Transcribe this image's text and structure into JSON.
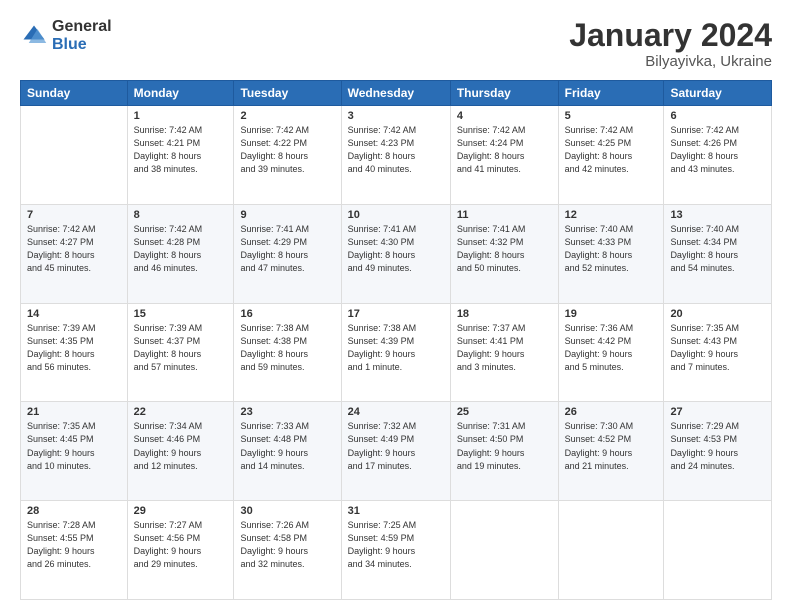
{
  "logo": {
    "general": "General",
    "blue": "Blue"
  },
  "title": {
    "month": "January 2024",
    "location": "Bilyayivka, Ukraine"
  },
  "headers": [
    "Sunday",
    "Monday",
    "Tuesday",
    "Wednesday",
    "Thursday",
    "Friday",
    "Saturday"
  ],
  "weeks": [
    [
      {
        "day": "",
        "info": ""
      },
      {
        "day": "1",
        "info": "Sunrise: 7:42 AM\nSunset: 4:21 PM\nDaylight: 8 hours\nand 38 minutes."
      },
      {
        "day": "2",
        "info": "Sunrise: 7:42 AM\nSunset: 4:22 PM\nDaylight: 8 hours\nand 39 minutes."
      },
      {
        "day": "3",
        "info": "Sunrise: 7:42 AM\nSunset: 4:23 PM\nDaylight: 8 hours\nand 40 minutes."
      },
      {
        "day": "4",
        "info": "Sunrise: 7:42 AM\nSunset: 4:24 PM\nDaylight: 8 hours\nand 41 minutes."
      },
      {
        "day": "5",
        "info": "Sunrise: 7:42 AM\nSunset: 4:25 PM\nDaylight: 8 hours\nand 42 minutes."
      },
      {
        "day": "6",
        "info": "Sunrise: 7:42 AM\nSunset: 4:26 PM\nDaylight: 8 hours\nand 43 minutes."
      }
    ],
    [
      {
        "day": "7",
        "info": "Sunrise: 7:42 AM\nSunset: 4:27 PM\nDaylight: 8 hours\nand 45 minutes."
      },
      {
        "day": "8",
        "info": "Sunrise: 7:42 AM\nSunset: 4:28 PM\nDaylight: 8 hours\nand 46 minutes."
      },
      {
        "day": "9",
        "info": "Sunrise: 7:41 AM\nSunset: 4:29 PM\nDaylight: 8 hours\nand 47 minutes."
      },
      {
        "day": "10",
        "info": "Sunrise: 7:41 AM\nSunset: 4:30 PM\nDaylight: 8 hours\nand 49 minutes."
      },
      {
        "day": "11",
        "info": "Sunrise: 7:41 AM\nSunset: 4:32 PM\nDaylight: 8 hours\nand 50 minutes."
      },
      {
        "day": "12",
        "info": "Sunrise: 7:40 AM\nSunset: 4:33 PM\nDaylight: 8 hours\nand 52 minutes."
      },
      {
        "day": "13",
        "info": "Sunrise: 7:40 AM\nSunset: 4:34 PM\nDaylight: 8 hours\nand 54 minutes."
      }
    ],
    [
      {
        "day": "14",
        "info": "Sunrise: 7:39 AM\nSunset: 4:35 PM\nDaylight: 8 hours\nand 56 minutes."
      },
      {
        "day": "15",
        "info": "Sunrise: 7:39 AM\nSunset: 4:37 PM\nDaylight: 8 hours\nand 57 minutes."
      },
      {
        "day": "16",
        "info": "Sunrise: 7:38 AM\nSunset: 4:38 PM\nDaylight: 8 hours\nand 59 minutes."
      },
      {
        "day": "17",
        "info": "Sunrise: 7:38 AM\nSunset: 4:39 PM\nDaylight: 9 hours\nand 1 minute."
      },
      {
        "day": "18",
        "info": "Sunrise: 7:37 AM\nSunset: 4:41 PM\nDaylight: 9 hours\nand 3 minutes."
      },
      {
        "day": "19",
        "info": "Sunrise: 7:36 AM\nSunset: 4:42 PM\nDaylight: 9 hours\nand 5 minutes."
      },
      {
        "day": "20",
        "info": "Sunrise: 7:35 AM\nSunset: 4:43 PM\nDaylight: 9 hours\nand 7 minutes."
      }
    ],
    [
      {
        "day": "21",
        "info": "Sunrise: 7:35 AM\nSunset: 4:45 PM\nDaylight: 9 hours\nand 10 minutes."
      },
      {
        "day": "22",
        "info": "Sunrise: 7:34 AM\nSunset: 4:46 PM\nDaylight: 9 hours\nand 12 minutes."
      },
      {
        "day": "23",
        "info": "Sunrise: 7:33 AM\nSunset: 4:48 PM\nDaylight: 9 hours\nand 14 minutes."
      },
      {
        "day": "24",
        "info": "Sunrise: 7:32 AM\nSunset: 4:49 PM\nDaylight: 9 hours\nand 17 minutes."
      },
      {
        "day": "25",
        "info": "Sunrise: 7:31 AM\nSunset: 4:50 PM\nDaylight: 9 hours\nand 19 minutes."
      },
      {
        "day": "26",
        "info": "Sunrise: 7:30 AM\nSunset: 4:52 PM\nDaylight: 9 hours\nand 21 minutes."
      },
      {
        "day": "27",
        "info": "Sunrise: 7:29 AM\nSunset: 4:53 PM\nDaylight: 9 hours\nand 24 minutes."
      }
    ],
    [
      {
        "day": "28",
        "info": "Sunrise: 7:28 AM\nSunset: 4:55 PM\nDaylight: 9 hours\nand 26 minutes."
      },
      {
        "day": "29",
        "info": "Sunrise: 7:27 AM\nSunset: 4:56 PM\nDaylight: 9 hours\nand 29 minutes."
      },
      {
        "day": "30",
        "info": "Sunrise: 7:26 AM\nSunset: 4:58 PM\nDaylight: 9 hours\nand 32 minutes."
      },
      {
        "day": "31",
        "info": "Sunrise: 7:25 AM\nSunset: 4:59 PM\nDaylight: 9 hours\nand 34 minutes."
      },
      {
        "day": "",
        "info": ""
      },
      {
        "day": "",
        "info": ""
      },
      {
        "day": "",
        "info": ""
      }
    ]
  ]
}
